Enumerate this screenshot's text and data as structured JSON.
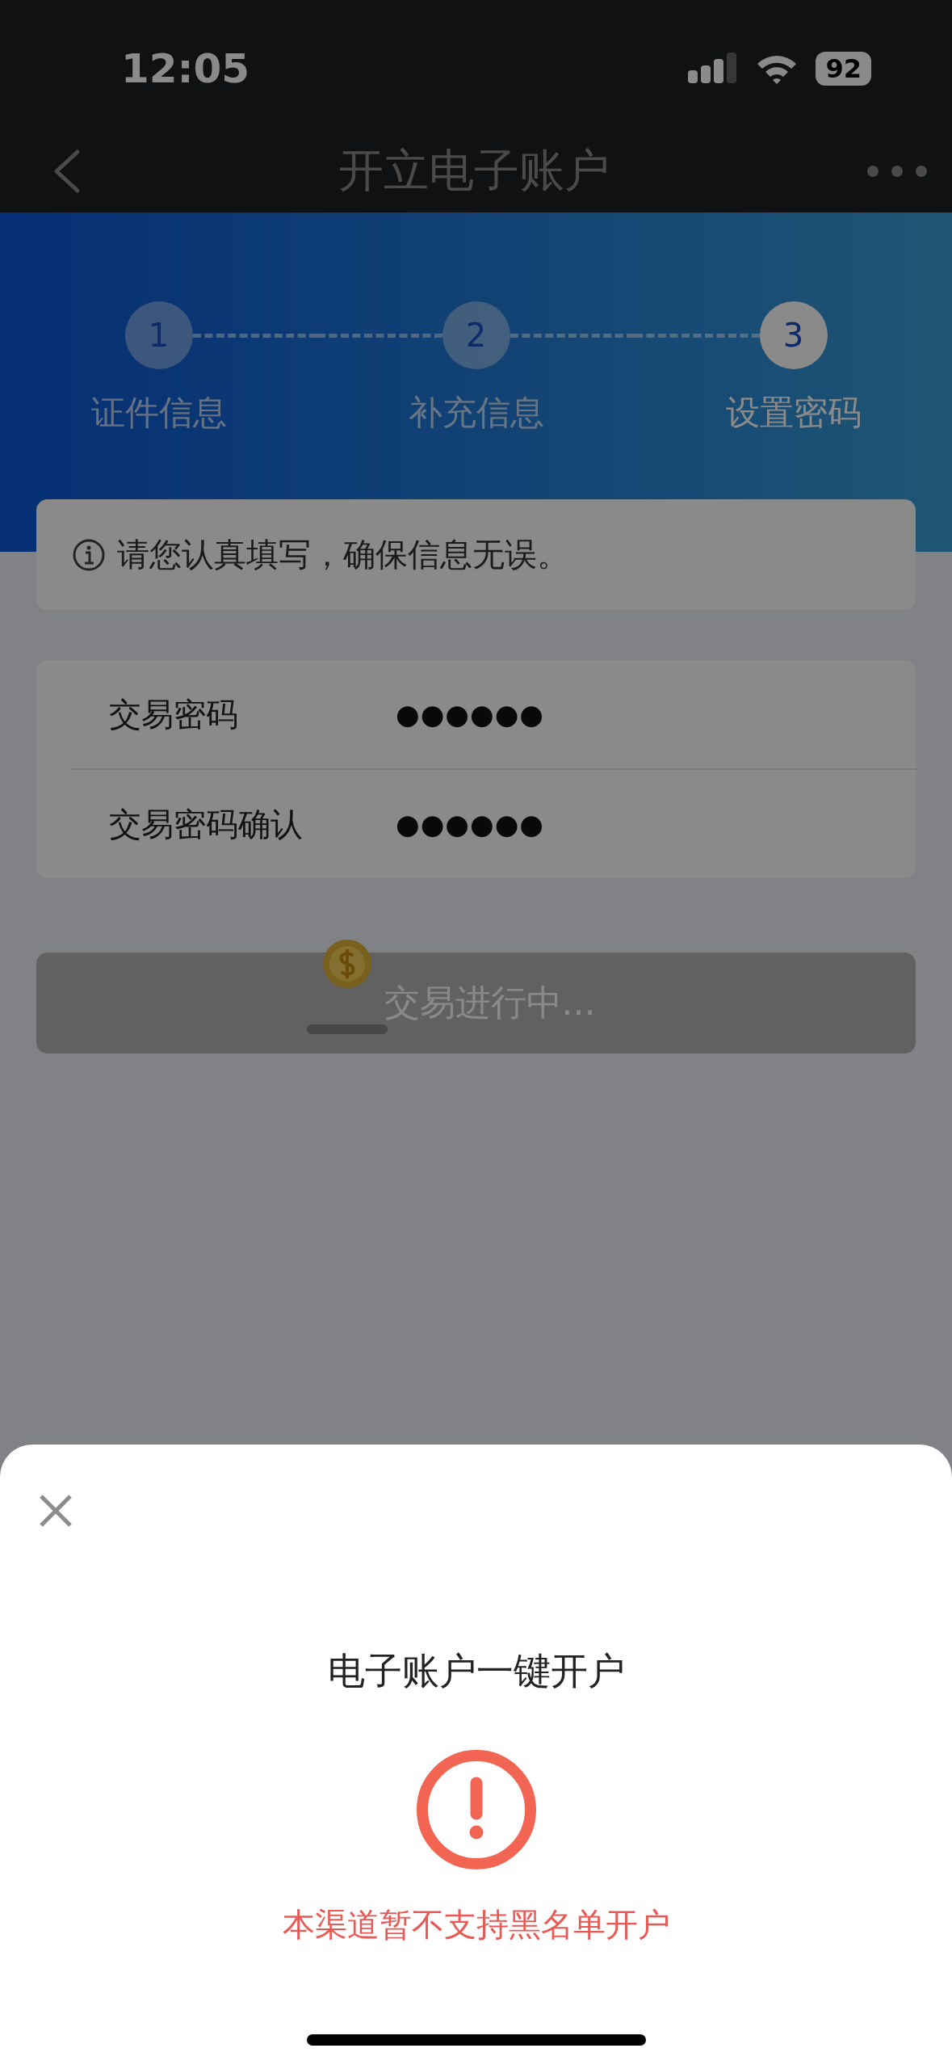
{
  "status_bar": {
    "time": "12:05",
    "battery": "92"
  },
  "nav": {
    "title": "开立电子账户"
  },
  "steps": [
    {
      "number": "1",
      "label": "证件信息",
      "selected": false
    },
    {
      "number": "2",
      "label": "补充信息",
      "selected": false
    },
    {
      "number": "3",
      "label": "设置密码",
      "selected": true
    }
  ],
  "notice": {
    "text": "请您认真填写，确保信息无误。"
  },
  "fields": [
    {
      "label": "交易密码",
      "value": "●●●●●●"
    },
    {
      "label": "交易密码确认",
      "value": "●●●●●●"
    }
  ],
  "submit": {
    "label": "交易进行中...",
    "loading": true
  },
  "sheet": {
    "title": "电子账户一键开户",
    "message": "本渠道暂不支持黑名单开户"
  }
}
